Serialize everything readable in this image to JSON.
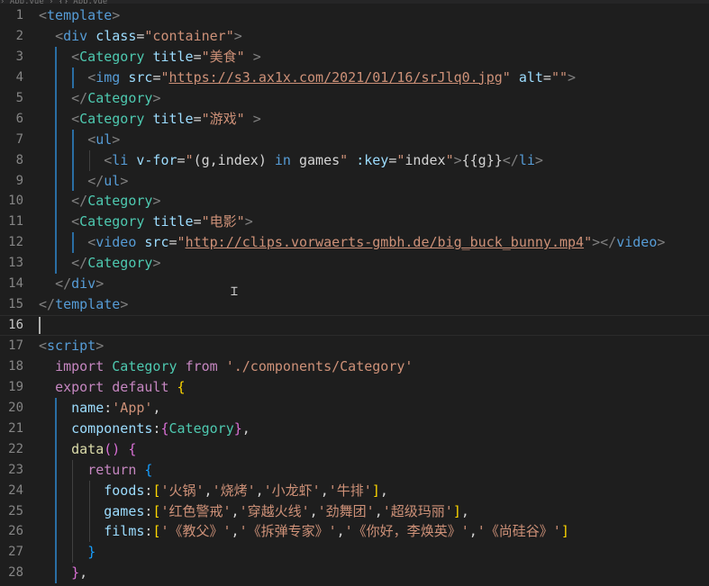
{
  "editor": {
    "breadcrumb": "› App.vue › {} App.vue",
    "lines": [
      {
        "n": "1",
        "tokens": [
          [
            "t-punc",
            "<"
          ],
          [
            "t-tag",
            "template"
          ],
          [
            "t-punc",
            ">"
          ]
        ]
      },
      {
        "n": "2",
        "tokens": [
          [
            "t-white",
            "  "
          ],
          [
            "t-punc",
            "<"
          ],
          [
            "t-tag",
            "div"
          ],
          [
            "t-white",
            " "
          ],
          [
            "t-attr",
            "class"
          ],
          [
            "t-white",
            "="
          ],
          [
            "t-str",
            "\"container\""
          ],
          [
            "t-punc",
            ">"
          ]
        ]
      },
      {
        "n": "3",
        "tokens": [
          [
            "t-white",
            "    "
          ],
          [
            "t-punc",
            "<"
          ],
          [
            "t-ctag",
            "Category"
          ],
          [
            "t-white",
            " "
          ],
          [
            "t-attr",
            "title"
          ],
          [
            "t-white",
            "="
          ],
          [
            "t-str",
            "\"美食\""
          ],
          [
            "t-white",
            " "
          ],
          [
            "t-punc",
            ">"
          ]
        ]
      },
      {
        "n": "4",
        "tokens": [
          [
            "t-white",
            "      "
          ],
          [
            "t-punc",
            "<"
          ],
          [
            "t-tag",
            "img"
          ],
          [
            "t-white",
            " "
          ],
          [
            "t-attr",
            "src"
          ],
          [
            "t-white",
            "="
          ],
          [
            "t-str",
            "\""
          ],
          [
            "t-url",
            "https://s3.ax1x.com/2021/01/16/srJlq0.jpg"
          ],
          [
            "t-str",
            "\""
          ],
          [
            "t-white",
            " "
          ],
          [
            "t-attr",
            "alt"
          ],
          [
            "t-white",
            "="
          ],
          [
            "t-str",
            "\"\""
          ],
          [
            "t-punc",
            ">"
          ]
        ]
      },
      {
        "n": "5",
        "tokens": [
          [
            "t-white",
            "    "
          ],
          [
            "t-punc",
            "</"
          ],
          [
            "t-ctag",
            "Category"
          ],
          [
            "t-punc",
            ">"
          ]
        ]
      },
      {
        "n": "6",
        "tokens": [
          [
            "t-white",
            "    "
          ],
          [
            "t-punc",
            "<"
          ],
          [
            "t-ctag",
            "Category"
          ],
          [
            "t-white",
            " "
          ],
          [
            "t-attr",
            "title"
          ],
          [
            "t-white",
            "="
          ],
          [
            "t-str",
            "\"游戏\""
          ],
          [
            "t-white",
            " "
          ],
          [
            "t-punc",
            ">"
          ]
        ]
      },
      {
        "n": "7",
        "tokens": [
          [
            "t-white",
            "      "
          ],
          [
            "t-punc",
            "<"
          ],
          [
            "t-tag",
            "ul"
          ],
          [
            "t-punc",
            ">"
          ]
        ]
      },
      {
        "n": "8",
        "tokens": [
          [
            "t-white",
            "        "
          ],
          [
            "t-punc",
            "<"
          ],
          [
            "t-tag",
            "li"
          ],
          [
            "t-white",
            " "
          ],
          [
            "t-attr",
            "v-for"
          ],
          [
            "t-white",
            "="
          ],
          [
            "t-str",
            "\""
          ],
          [
            "t-white",
            "(g,index) "
          ],
          [
            "t-kw2",
            "in"
          ],
          [
            "t-white",
            " games"
          ],
          [
            "t-str",
            "\""
          ],
          [
            "t-white",
            " "
          ],
          [
            "t-attr",
            ":key"
          ],
          [
            "t-white",
            "="
          ],
          [
            "t-str",
            "\""
          ],
          [
            "t-white",
            "index"
          ],
          [
            "t-str",
            "\""
          ],
          [
            "t-punc",
            ">"
          ],
          [
            "t-white",
            "{{g}}"
          ],
          [
            "t-punc",
            "</"
          ],
          [
            "t-tag",
            "li"
          ],
          [
            "t-punc",
            ">"
          ]
        ]
      },
      {
        "n": "9",
        "tokens": [
          [
            "t-white",
            "      "
          ],
          [
            "t-punc",
            "</"
          ],
          [
            "t-tag",
            "ul"
          ],
          [
            "t-punc",
            ">"
          ]
        ]
      },
      {
        "n": "10",
        "tokens": [
          [
            "t-white",
            "    "
          ],
          [
            "t-punc",
            "</"
          ],
          [
            "t-ctag",
            "Category"
          ],
          [
            "t-punc",
            ">"
          ]
        ]
      },
      {
        "n": "11",
        "tokens": [
          [
            "t-white",
            "    "
          ],
          [
            "t-punc",
            "<"
          ],
          [
            "t-ctag",
            "Category"
          ],
          [
            "t-white",
            " "
          ],
          [
            "t-attr",
            "title"
          ],
          [
            "t-white",
            "="
          ],
          [
            "t-str",
            "\"电影\""
          ],
          [
            "t-punc",
            ">"
          ]
        ]
      },
      {
        "n": "12",
        "tokens": [
          [
            "t-white",
            "      "
          ],
          [
            "t-punc",
            "<"
          ],
          [
            "t-tag",
            "video"
          ],
          [
            "t-white",
            " "
          ],
          [
            "t-attr",
            "src"
          ],
          [
            "t-white",
            "="
          ],
          [
            "t-str",
            "\""
          ],
          [
            "t-url",
            "http://clips.vorwaerts-gmbh.de/big_buck_bunny.mp4"
          ],
          [
            "t-str",
            "\""
          ],
          [
            "t-punc",
            "></"
          ],
          [
            "t-tag",
            "video"
          ],
          [
            "t-punc",
            ">"
          ]
        ]
      },
      {
        "n": "13",
        "tokens": [
          [
            "t-white",
            "    "
          ],
          [
            "t-punc",
            "</"
          ],
          [
            "t-ctag",
            "Category"
          ],
          [
            "t-punc",
            ">"
          ]
        ]
      },
      {
        "n": "14",
        "tokens": [
          [
            "t-white",
            "  "
          ],
          [
            "t-punc",
            "</"
          ],
          [
            "t-tag",
            "div"
          ],
          [
            "t-punc",
            ">"
          ]
        ]
      },
      {
        "n": "15",
        "tokens": [
          [
            "t-punc",
            "</"
          ],
          [
            "t-tag",
            "template"
          ],
          [
            "t-punc",
            ">"
          ]
        ]
      },
      {
        "n": "16",
        "tokens": []
      },
      {
        "n": "17",
        "tokens": [
          [
            "t-punc",
            "<"
          ],
          [
            "t-tag",
            "script"
          ],
          [
            "t-punc",
            ">"
          ]
        ]
      },
      {
        "n": "18",
        "tokens": [
          [
            "t-white",
            "  "
          ],
          [
            "t-kw",
            "import"
          ],
          [
            "t-white",
            " "
          ],
          [
            "t-cls",
            "Category"
          ],
          [
            "t-white",
            " "
          ],
          [
            "t-kw",
            "from"
          ],
          [
            "t-white",
            " "
          ],
          [
            "t-str",
            "'./components/Category'"
          ]
        ]
      },
      {
        "n": "19",
        "tokens": [
          [
            "t-white",
            "  "
          ],
          [
            "t-kw",
            "export"
          ],
          [
            "t-white",
            " "
          ],
          [
            "t-kw",
            "default"
          ],
          [
            "t-white",
            " "
          ],
          [
            "t-brk",
            "{"
          ]
        ]
      },
      {
        "n": "20",
        "tokens": [
          [
            "t-white",
            "    "
          ],
          [
            "t-prop",
            "name"
          ],
          [
            "t-white",
            ":"
          ],
          [
            "t-str",
            "'App'"
          ],
          [
            "t-white",
            ","
          ]
        ]
      },
      {
        "n": "21",
        "tokens": [
          [
            "t-white",
            "    "
          ],
          [
            "t-prop",
            "components"
          ],
          [
            "t-white",
            ":"
          ],
          [
            "t-brk2",
            "{"
          ],
          [
            "t-cls",
            "Category"
          ],
          [
            "t-brk2",
            "}"
          ],
          [
            "t-white",
            ","
          ]
        ]
      },
      {
        "n": "22",
        "tokens": [
          [
            "t-white",
            "    "
          ],
          [
            "t-fn",
            "data"
          ],
          [
            "t-brk2",
            "()"
          ],
          [
            "t-white",
            " "
          ],
          [
            "t-brk2",
            "{"
          ]
        ]
      },
      {
        "n": "23",
        "tokens": [
          [
            "t-white",
            "      "
          ],
          [
            "t-kw",
            "return"
          ],
          [
            "t-white",
            " "
          ],
          [
            "t-brk3",
            "{"
          ]
        ]
      },
      {
        "n": "24",
        "tokens": [
          [
            "t-white",
            "        "
          ],
          [
            "t-prop",
            "foods"
          ],
          [
            "t-white",
            ":"
          ],
          [
            "t-brk",
            "["
          ],
          [
            "t-str",
            "'火锅'"
          ],
          [
            "t-white",
            ","
          ],
          [
            "t-str",
            "'烧烤'"
          ],
          [
            "t-white",
            ","
          ],
          [
            "t-str",
            "'小龙虾'"
          ],
          [
            "t-white",
            ","
          ],
          [
            "t-str",
            "'牛排'"
          ],
          [
            "t-brk",
            "]"
          ],
          [
            "t-white",
            ","
          ]
        ]
      },
      {
        "n": "25",
        "tokens": [
          [
            "t-white",
            "        "
          ],
          [
            "t-prop",
            "games"
          ],
          [
            "t-white",
            ":"
          ],
          [
            "t-brk",
            "["
          ],
          [
            "t-str",
            "'红色警戒'"
          ],
          [
            "t-white",
            ","
          ],
          [
            "t-str",
            "'穿越火线'"
          ],
          [
            "t-white",
            ","
          ],
          [
            "t-str",
            "'劲舞团'"
          ],
          [
            "t-white",
            ","
          ],
          [
            "t-str",
            "'超级玛丽'"
          ],
          [
            "t-brk",
            "]"
          ],
          [
            "t-white",
            ","
          ]
        ]
      },
      {
        "n": "26",
        "tokens": [
          [
            "t-white",
            "        "
          ],
          [
            "t-prop",
            "films"
          ],
          [
            "t-white",
            ":"
          ],
          [
            "t-brk",
            "["
          ],
          [
            "t-str",
            "'《教父》'"
          ],
          [
            "t-white",
            ","
          ],
          [
            "t-str",
            "'《拆弹专家》'"
          ],
          [
            "t-white",
            ","
          ],
          [
            "t-str",
            "'《你好，李焕英》'"
          ],
          [
            "t-white",
            ","
          ],
          [
            "t-str",
            "'《尚硅谷》'"
          ],
          [
            "t-brk",
            "]"
          ]
        ]
      },
      {
        "n": "27",
        "tokens": [
          [
            "t-white",
            "      "
          ],
          [
            "t-brk3",
            "}"
          ]
        ]
      },
      {
        "n": "28",
        "tokens": [
          [
            "t-white",
            "    "
          ],
          [
            "t-brk2",
            "}"
          ],
          [
            "t-white",
            ","
          ]
        ]
      }
    ],
    "active_line": "16"
  },
  "colors": {
    "background": "#1e1e1e",
    "line_number": "#858585",
    "indent_guide_active": "#2a6ea4"
  }
}
